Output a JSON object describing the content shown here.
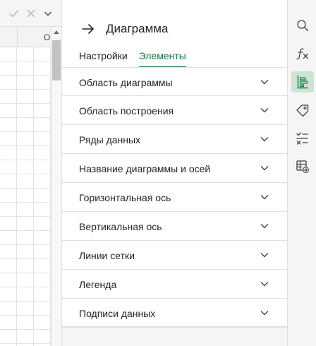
{
  "sheet": {
    "column_letter": "O",
    "formula_bar": {
      "confirm_icon": "check-icon",
      "cancel_icon": "close-icon",
      "expand_icon": "chevron-down-icon"
    }
  },
  "pane": {
    "back_icon": "arrow-right-icon",
    "title": "Диаграмма",
    "tabs": [
      {
        "label": "Настройки",
        "active": false
      },
      {
        "label": "Элементы",
        "active": true
      }
    ],
    "sections": [
      {
        "label": "Область диаграммы"
      },
      {
        "label": "Область построения"
      },
      {
        "label": "Ряды данных"
      },
      {
        "label": "Название диаграммы и осей"
      },
      {
        "label": "Горизонтальная ось"
      },
      {
        "label": "Вертикальная ось"
      },
      {
        "label": "Линии сетки"
      },
      {
        "label": "Легенда"
      },
      {
        "label": "Подписи данных"
      }
    ]
  },
  "rail": {
    "buttons": [
      {
        "icon": "search-icon",
        "active": false
      },
      {
        "icon": "function-icon",
        "active": false
      },
      {
        "icon": "chart-settings-icon",
        "active": true
      },
      {
        "icon": "tag-icon",
        "active": false
      },
      {
        "icon": "checklist-icon",
        "active": false
      },
      {
        "icon": "table-settings-icon",
        "active": false
      }
    ]
  },
  "colors": {
    "accent": "#107c41",
    "active_rail_bg": "#cde3d3",
    "pane_bg": "#f5f5f5"
  }
}
